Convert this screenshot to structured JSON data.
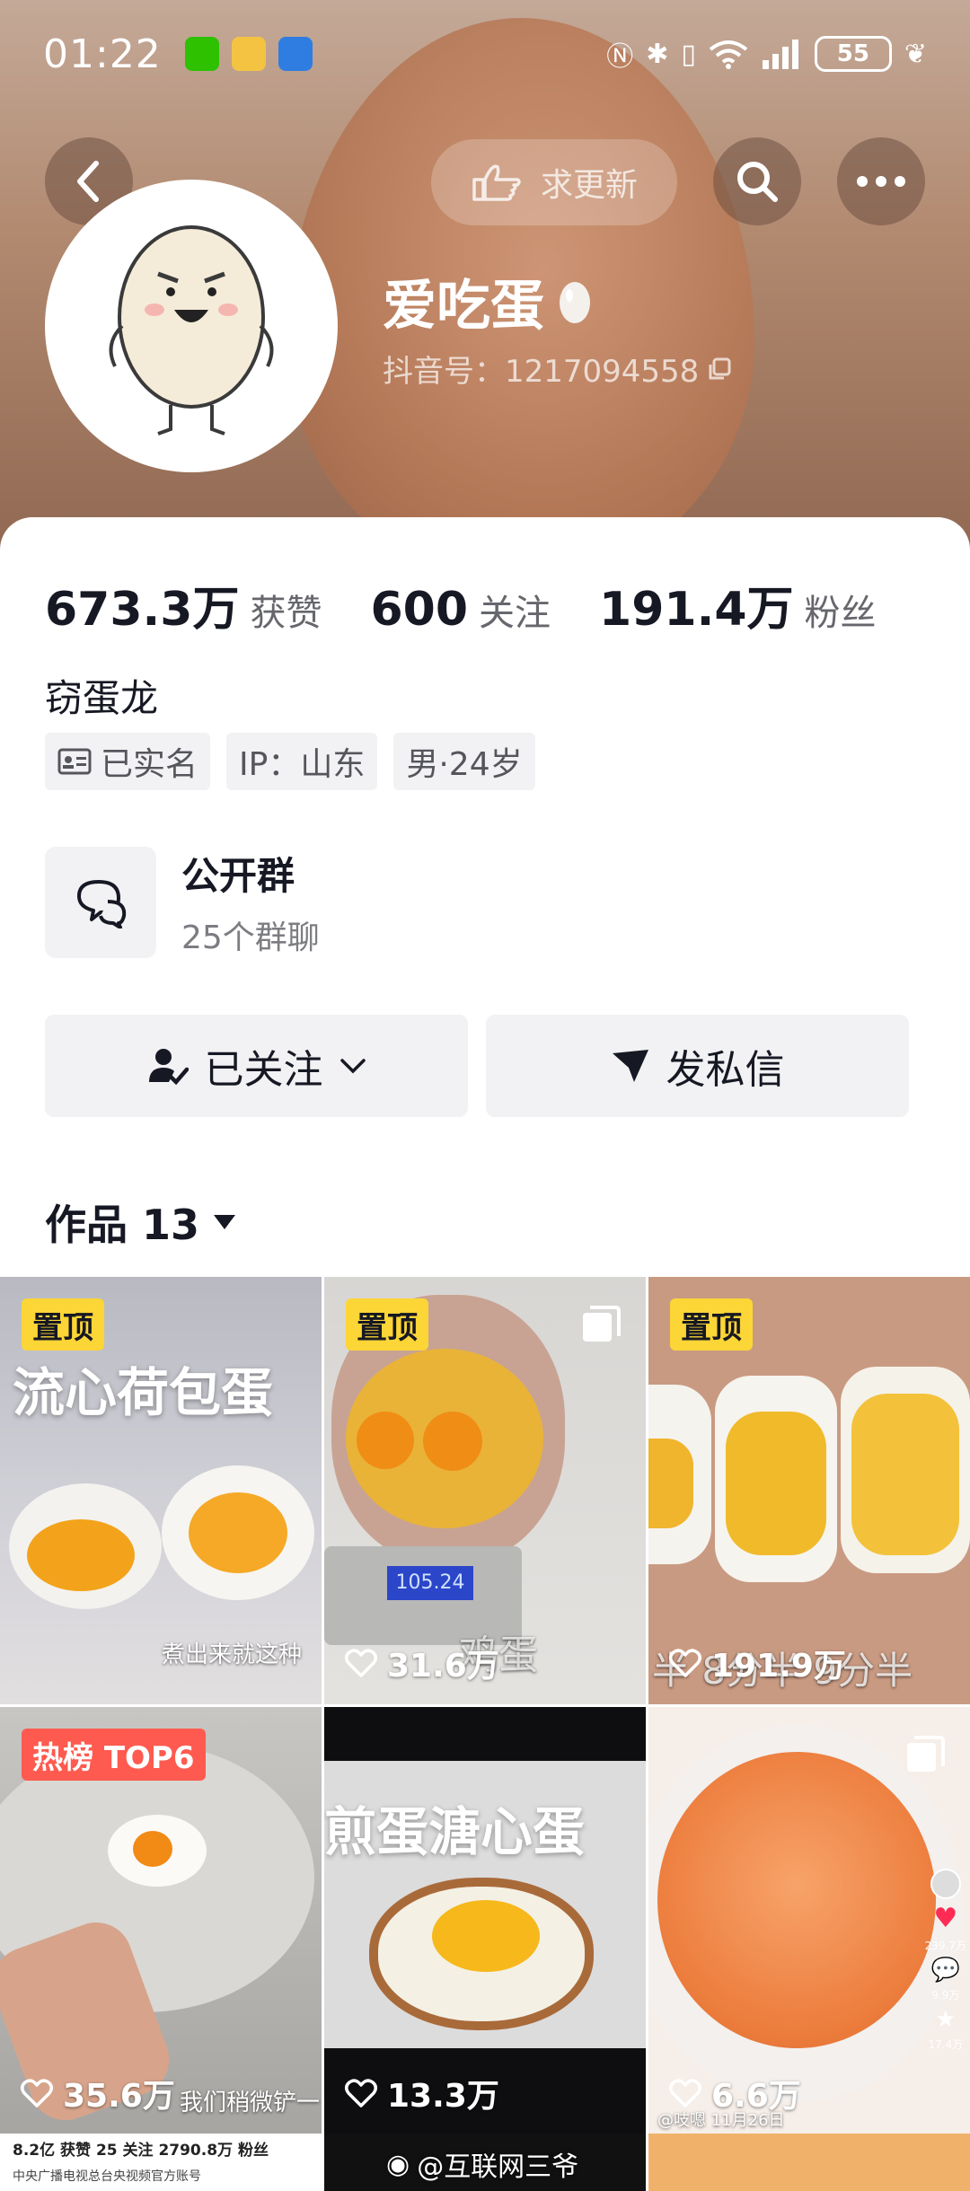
{
  "status_bar": {
    "time": "01:22",
    "battery": "55",
    "signal_label": "6"
  },
  "header": {
    "pill_button_label": "求更新",
    "nickname": "爱吃蛋",
    "douyin_id": "抖音号：1217094558"
  },
  "stats": [
    {
      "value": "673.3万",
      "label": "获赞"
    },
    {
      "value": "600",
      "label": "关注"
    },
    {
      "value": "191.4万",
      "label": "粉丝"
    }
  ],
  "bio": "窃蛋龙",
  "tags": [
    {
      "label": "已实名",
      "icon": "id-card-icon"
    },
    {
      "label": "IP：山东"
    },
    {
      "label": "男·24岁"
    }
  ],
  "group": {
    "title": "公开群",
    "subtitle": "25个群聊"
  },
  "actions": {
    "follow_label": "已关注",
    "message_label": "发私信"
  },
  "works": {
    "label": "作品 13"
  },
  "tiles": [
    {
      "badge": "置顶",
      "likes": "",
      "overlay": "流心荷包蛋",
      "caption": "煮出来就这种"
    },
    {
      "badge": "置顶",
      "likes": "31.6万",
      "overlay": "",
      "caption": "鸡蛋",
      "scale": "105.24"
    },
    {
      "badge": "置顶",
      "likes": "191.9万",
      "overlay": "",
      "caption": "半  8分半  9分半"
    },
    {
      "badge": "热榜 TOP6",
      "likes": "35.6万",
      "overlay": "",
      "caption": "我们稍微铲一"
    },
    {
      "badge": "",
      "likes": "13.3万",
      "overlay": "煎蛋溏心蛋",
      "caption": ""
    },
    {
      "badge": "",
      "likes": "6.6万",
      "overlay": "",
      "caption": "@吱嗯  11月26日",
      "side_counts": [
        "239.7万",
        "9.9万",
        "17.4万"
      ]
    }
  ],
  "bottom_strip": {
    "stats_line": "8.2亿 获赞  25 关注  2790.8万 粉丝",
    "account_line": "中央广播电视总台央视频官方账号",
    "watermark": "@互联网三爷"
  },
  "colors": {
    "pin_badge": "#fcd536",
    "hot_badge": "#fe5a4f",
    "button_bg": "#f2f2f4"
  }
}
